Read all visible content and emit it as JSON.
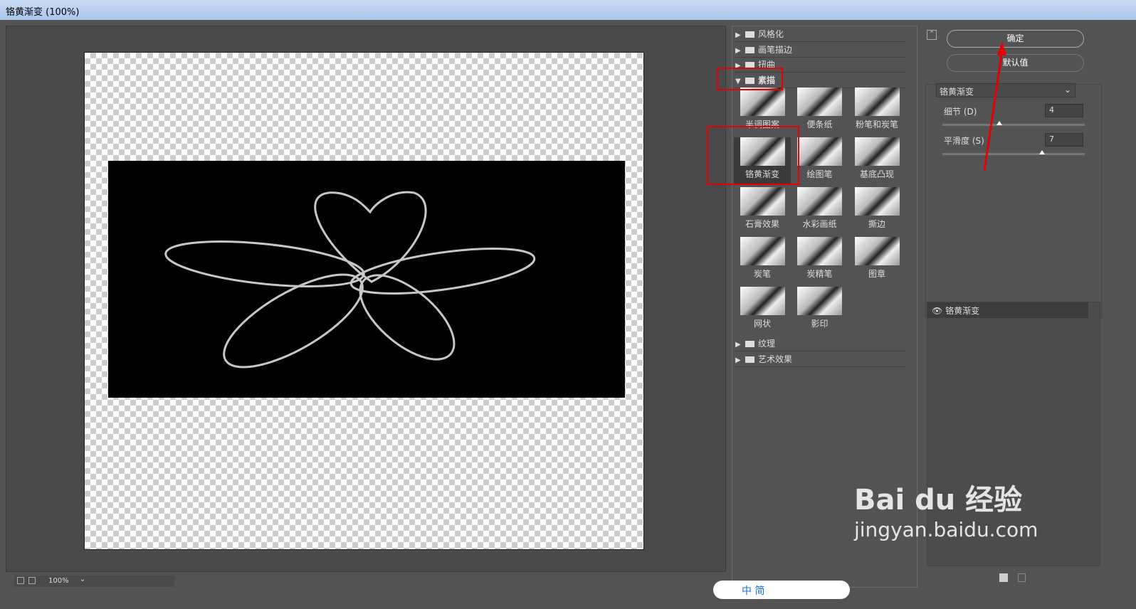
{
  "window": {
    "title": "铬黄渐变 (100%)"
  },
  "status": {
    "zoom": "100%"
  },
  "filter_gallery": {
    "categories_top": [
      {
        "label": "风格化",
        "expanded": false
      },
      {
        "label": "画笔描边",
        "expanded": false
      },
      {
        "label": "扭曲",
        "expanded": false
      },
      {
        "label": "素描",
        "expanded": true
      }
    ],
    "thumbnails": [
      "半调图案",
      "便条纸",
      "粉笔和炭笔",
      "铬黄渐变",
      "绘图笔",
      "基底凸现",
      "石膏效果",
      "水彩画纸",
      "撕边",
      "炭笔",
      "炭精笔",
      "图章",
      "网状",
      "影印"
    ],
    "selected": "铬黄渐变",
    "categories_bottom": [
      {
        "label": "纹理",
        "expanded": false
      },
      {
        "label": "艺术效果",
        "expanded": false
      }
    ]
  },
  "settings": {
    "ok_label": "确定",
    "default_label": "默认值",
    "filter_select": "铬黄渐变",
    "detail": {
      "label": "细节 (D)",
      "value": "4",
      "min": 0,
      "max": 10
    },
    "smoothness": {
      "label": "平滑度 (S)",
      "value": "7",
      "min": 0,
      "max": 10
    }
  },
  "layers": {
    "items": [
      {
        "label": "铬黄渐变",
        "visible": true
      }
    ]
  },
  "watermark": {
    "brand": "Bai du 经验",
    "url": "jingyan.baidu.com"
  },
  "ime": {
    "items": [
      "中",
      "简"
    ]
  },
  "colors": {
    "accent_red": "#e60000",
    "panel": "#535353"
  }
}
